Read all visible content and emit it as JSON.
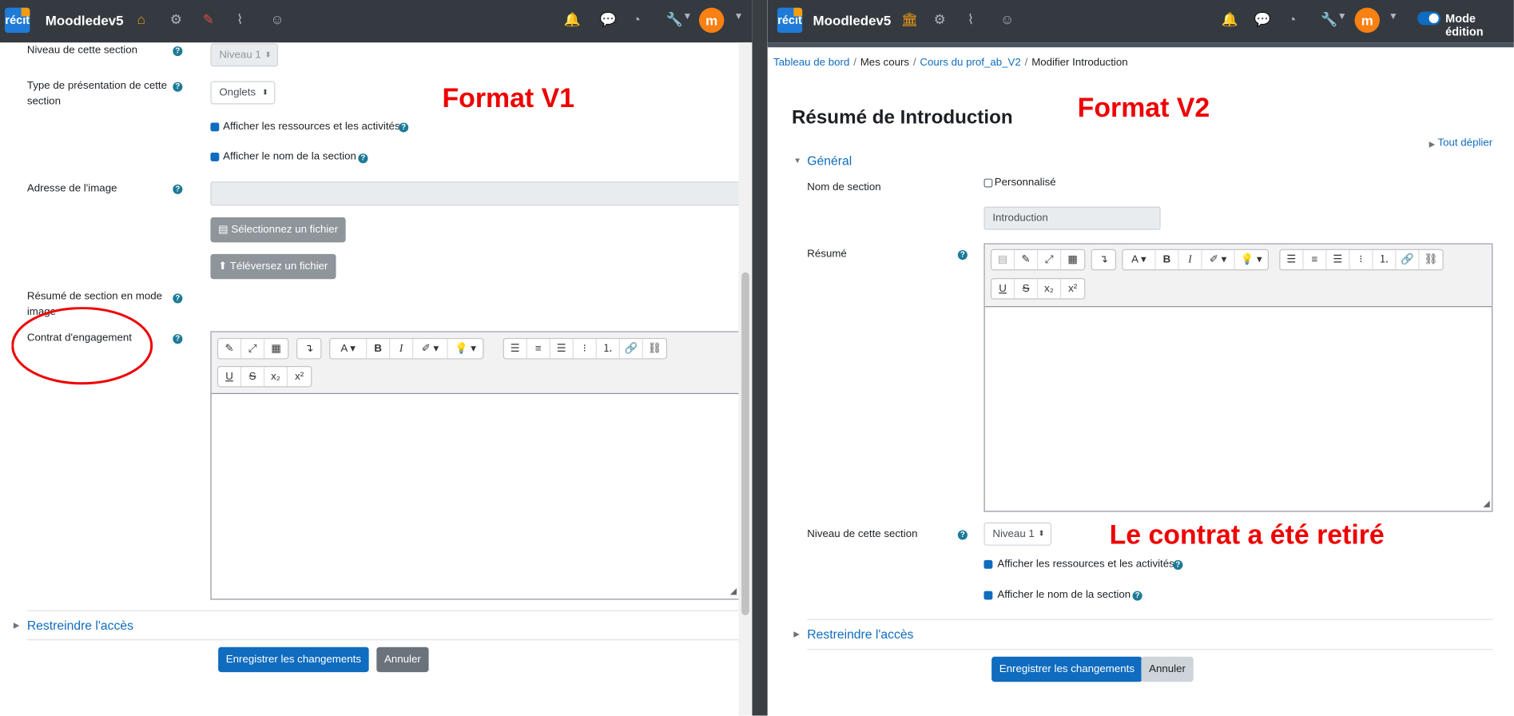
{
  "left": {
    "nav": {
      "logo": "récit",
      "brand": "Moodledev5"
    },
    "annotation": "Format V1",
    "fields": {
      "niveau_label": "Niveau de cette section",
      "niveau_value": "Niveau 1",
      "type_label": "Type de présentation de cette section",
      "type_value": "Onglets",
      "show_resources": "Afficher les ressources et les activités",
      "show_name": "Afficher le nom de la section",
      "image_label": "Adresse de l'image",
      "select_file": "Sélectionnez un fichier",
      "upload_file": "Téléversez un fichier",
      "resume_image_label": "Résumé de section en mode image",
      "contrat_label": "Contrat d'engagement"
    },
    "restrict": "Restreindre l'accès",
    "save": "Enregistrer les changements",
    "cancel": "Annuler"
  },
  "right": {
    "nav": {
      "logo": "récit",
      "brand": "Moodledev5",
      "mode": "Mode édition"
    },
    "breadcrumb": [
      "Tableau de bord",
      "Mes cours",
      "Cours du prof_ab_V2",
      "Modifier Introduction"
    ],
    "title": "Résumé de Introduction",
    "annotation": "Format V2",
    "expand_all": "Tout déplier",
    "general": "Général",
    "fields": {
      "name_label": "Nom de section",
      "custom": "Personnalisé",
      "name_value": "Introduction",
      "resume_label": "Résumé",
      "niveau_label": "Niveau de cette section",
      "niveau_value": "Niveau 1",
      "show_resources": "Afficher les ressources et les activités",
      "show_name": "Afficher le nom de la section"
    },
    "annotation2": "Le contrat a été retiré",
    "restrict": "Restreindre l'accès",
    "save": "Enregistrer les changements",
    "cancel": "Annuler"
  },
  "toolbar": {
    "font": "A",
    "bold": "B",
    "italic": "I",
    "underline": "U",
    "strike": "S",
    "sub": "x₂",
    "sup": "x²"
  },
  "colors": {
    "nav": "#343a40",
    "primary": "#0f6cbf",
    "annotation": "#e00000",
    "help": "#1c7a96"
  }
}
